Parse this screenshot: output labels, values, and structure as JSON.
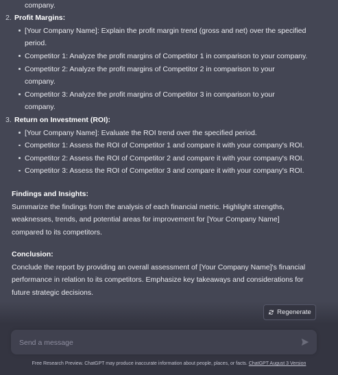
{
  "message": {
    "lines": [
      {
        "type": "cont",
        "text": "company."
      },
      {
        "type": "heading",
        "num": "2.",
        "text": "Profit Margins:"
      },
      {
        "type": "bullet",
        "text": "[Your Company Name]: Explain the profit margin trend (gross and net) over the specified"
      },
      {
        "type": "cont",
        "text": "period."
      },
      {
        "type": "bullet",
        "text": "Competitor 1: Analyze the profit margins of Competitor 1 in comparison to your company."
      },
      {
        "type": "bullet",
        "text": "Competitor 2: Analyze the profit margins of Competitor 2 in comparison to your"
      },
      {
        "type": "cont",
        "text": "company."
      },
      {
        "type": "bullet",
        "text": "Competitor 3: Analyze the profit margins of Competitor 3 in comparison to your"
      },
      {
        "type": "cont",
        "text": "company."
      },
      {
        "type": "heading",
        "num": "3.",
        "text": "Return on Investment (ROI):"
      },
      {
        "type": "bullet",
        "text": "[Your Company Name]: Evaluate the ROI trend over the specified period."
      },
      {
        "type": "bullet",
        "text": "Competitor 1: Assess the ROI of Competitor 1 and compare it with your company's ROI."
      },
      {
        "type": "bullet",
        "text": "Competitor 2: Assess the ROI of Competitor 2 and compare it with your company's ROI."
      },
      {
        "type": "bullet",
        "text": "Competitor 3: Assess the ROI of Competitor 3 and compare it with your company's ROI."
      }
    ],
    "findings_title": "Findings and Insights:",
    "findings_lines": [
      "Summarize the findings from the analysis of each financial metric. Highlight strengths,",
      "weaknesses, trends, and potential areas for improvement for [Your Company Name]",
      "compared to its competitors."
    ],
    "conclusion_title": "Conclusion:",
    "conclusion_lines": [
      "Conclude the report by providing an overall assessment of [Your Company Name]'s financial",
      "performance in relation to its competitors. Emphasize key takeaways and considerations for",
      "future strategic decisions."
    ]
  },
  "regenerate_label": "Regenerate",
  "input": {
    "placeholder": "Send a message",
    "value": ""
  },
  "footer": {
    "text": "Free Research Preview. ChatGPT may produce inaccurate information about people, places, or facts.",
    "link": "ChatGPT August 3 Version"
  },
  "colors": {
    "message_bg": "#444654",
    "page_bg": "#343541",
    "input_bg": "#40414f",
    "text": "#ececf1"
  },
  "icons": {
    "regenerate": "refresh-icon",
    "send": "send-icon"
  }
}
